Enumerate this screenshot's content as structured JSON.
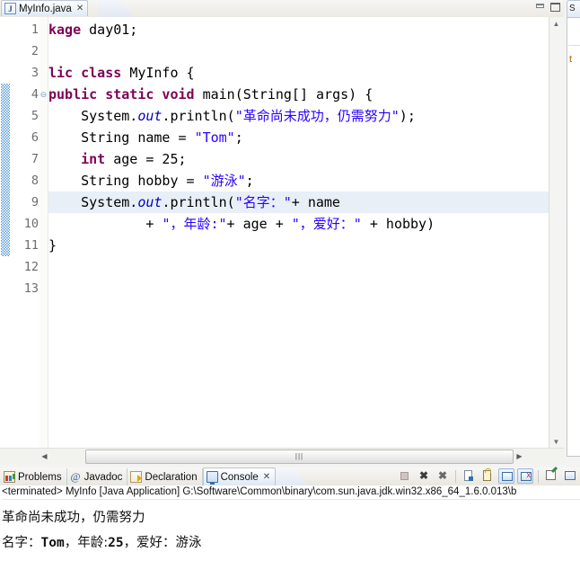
{
  "editor": {
    "tab": {
      "label": "MyInfo.java",
      "icon": "java-file-icon",
      "close_glyph": "✕"
    },
    "window_controls": {
      "minimize": "minimize-icon",
      "maximize": "maximize-icon"
    },
    "line_numbers": [
      "1",
      "2",
      "3",
      "4",
      "5",
      "6",
      "7",
      "8",
      "9",
      "10",
      "11",
      "12",
      "13"
    ],
    "fold_marker_glyph": "⊖",
    "current_line": 9,
    "code_lines": [
      {
        "n": 1,
        "segments": [
          {
            "t": "kage ",
            "c": "kw"
          },
          {
            "t": "day01;",
            "c": ""
          }
        ]
      },
      {
        "n": 2,
        "segments": []
      },
      {
        "n": 3,
        "segments": [
          {
            "t": "lic class ",
            "c": "kw"
          },
          {
            "t": "MyInfo {",
            "c": ""
          }
        ]
      },
      {
        "n": 4,
        "segments": [
          {
            "t": "public static void ",
            "c": "kw"
          },
          {
            "t": "main(String[] args) {",
            "c": ""
          }
        ]
      },
      {
        "n": 5,
        "segments": [
          {
            "t": "    System.",
            "c": ""
          },
          {
            "t": "out",
            "c": "fld"
          },
          {
            "t": ".println(",
            "c": ""
          },
          {
            "t": "\"革命尚未成功，仍需努力\"",
            "c": "str"
          },
          {
            "t": ");",
            "c": ""
          }
        ]
      },
      {
        "n": 6,
        "segments": [
          {
            "t": "    String name = ",
            "c": ""
          },
          {
            "t": "\"Tom\"",
            "c": "str"
          },
          {
            "t": ";",
            "c": ""
          }
        ]
      },
      {
        "n": 7,
        "segments": [
          {
            "t": "    ",
            "c": ""
          },
          {
            "t": "int",
            "c": "kw"
          },
          {
            "t": " age = 25;",
            "c": ""
          }
        ]
      },
      {
        "n": 8,
        "segments": [
          {
            "t": "    String hobby = ",
            "c": ""
          },
          {
            "t": "\"游泳\"",
            "c": "str"
          },
          {
            "t": ";",
            "c": ""
          }
        ]
      },
      {
        "n": 9,
        "segments": [
          {
            "t": "    System.",
            "c": ""
          },
          {
            "t": "out",
            "c": "fld"
          },
          {
            "t": ".println(",
            "c": ""
          },
          {
            "t": "\"名字：\"",
            "c": "str"
          },
          {
            "t": "+ name",
            "c": ""
          }
        ]
      },
      {
        "n": 10,
        "segments": [
          {
            "t": "            + ",
            "c": ""
          },
          {
            "t": "\"，年龄:\"",
            "c": "str"
          },
          {
            "t": "+ age + ",
            "c": ""
          },
          {
            "t": "\"，爱好：\"",
            "c": "str"
          },
          {
            "t": " + hobby)",
            "c": ""
          }
        ]
      },
      {
        "n": 11,
        "segments": [
          {
            "t": "}",
            "c": ""
          }
        ]
      },
      {
        "n": 12,
        "segments": []
      },
      {
        "n": 13,
        "segments": []
      }
    ],
    "annotation_range": {
      "from_line": 4,
      "to_line": 11
    },
    "v_scroll": {
      "up_glyph": "▲",
      "down_glyph": "▼"
    },
    "h_scroll": {
      "left_glyph": "◀",
      "right_glyph": "▶",
      "thumb_grip": "|||"
    }
  },
  "outline_sliver": {
    "tab_label": "S",
    "items": [
      {
        "label": "t"
      }
    ]
  },
  "console_panel": {
    "tabs": [
      {
        "label": "Problems",
        "icon": "problems-icon",
        "active": false
      },
      {
        "label": "Javadoc",
        "icon": "javadoc-icon",
        "active": false
      },
      {
        "label": "Declaration",
        "icon": "declaration-icon",
        "active": false
      },
      {
        "label": "Console",
        "icon": "console-icon",
        "active": true,
        "close_glyph": "✕"
      }
    ],
    "toolbar": [
      {
        "name": "terminate-button",
        "glyph": ""
      },
      {
        "name": "remove-launch-button",
        "glyph": "✖"
      },
      {
        "name": "remove-all-terminated-button",
        "glyph": "✖"
      },
      {
        "name": "clear-console-button",
        "glyph": ""
      },
      {
        "name": "scroll-lock-button",
        "glyph": ""
      },
      {
        "name": "show-console-on-output-button",
        "glyph": ""
      },
      {
        "name": "show-console-on-error-button",
        "glyph": ""
      },
      {
        "name": "pin-console-button",
        "glyph": ""
      },
      {
        "name": "display-selected-console-button",
        "glyph": ""
      }
    ],
    "terminated_line": "<terminated> MyInfo [Java Application] G:\\Software\\Common\\binary\\com.sun.java.jdk.win32.x86_64_1.6.0.013\\b",
    "output_lines": [
      {
        "text": "革命尚未成功，仍需努力"
      },
      {
        "prefix": "名字：",
        "value1": "Tom",
        "mid": "，年龄:",
        "value2": "25",
        "suffix": "，爱好：游泳"
      }
    ]
  },
  "colors": {
    "keyword": "#7f0055",
    "string": "#2a00ff",
    "field": "#0000c0",
    "current_line_bg": "#e8eff7",
    "annotation_bar": "#5b9bd5"
  }
}
